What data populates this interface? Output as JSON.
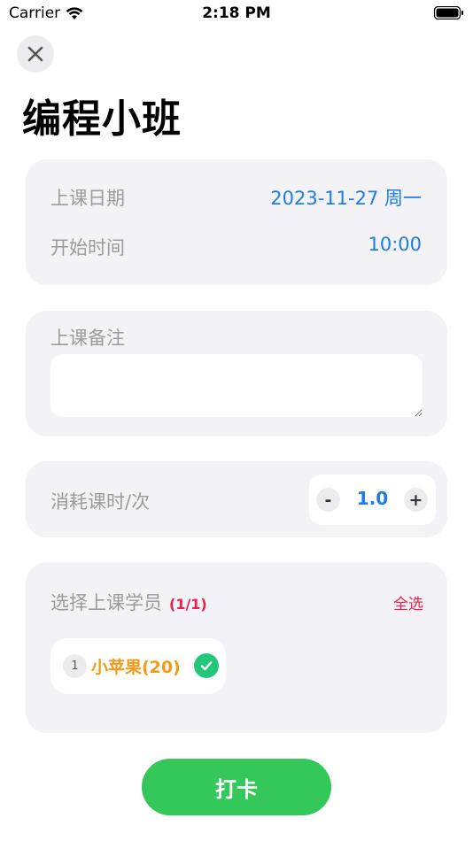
{
  "status_bar": {
    "carrier": "Carrier",
    "time": "2:18 PM"
  },
  "header": {
    "title": "编程小班",
    "close_icon": "close-icon"
  },
  "schedule": {
    "date_label": "上课日期",
    "date_value": "2023-11-27 周一",
    "start_label": "开始时间",
    "start_value": "10:00"
  },
  "notes": {
    "label": "上课备注",
    "value": "",
    "placeholder": ""
  },
  "hours": {
    "label": "消耗课时/次",
    "minus": "-",
    "value": "1.0",
    "plus": "+"
  },
  "students": {
    "label": "选择上课学员",
    "count": "(1/1)",
    "select_all": "全选",
    "items": [
      {
        "index": "1",
        "name": "小苹果(20)",
        "selected": true
      }
    ]
  },
  "footer": {
    "checkin_label": "打卡"
  },
  "colors": {
    "accent_blue": "#1d7ce6",
    "accent_red": "#e8204e",
    "accent_orange": "#f39a1a",
    "check_green": "#22c77a",
    "button_green": "#34c759",
    "card_bg": "#f2f2f7"
  }
}
